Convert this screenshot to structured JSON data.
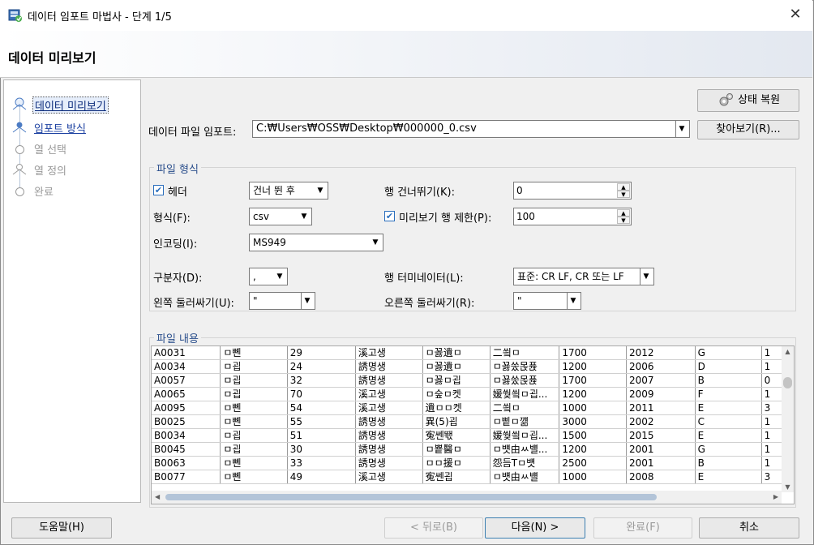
{
  "window": {
    "title": "데이터 임포트 마법사 - 단계 1/5",
    "close_glyph": "✕",
    "header_title": "데이터 미리보기"
  },
  "nav": {
    "items": [
      {
        "label": "데이터 미리보기",
        "state": "active"
      },
      {
        "label": "임포트 방식",
        "state": "link"
      },
      {
        "label": "열 선택",
        "state": "disabled"
      },
      {
        "label": "열 정의",
        "state": "disabled"
      },
      {
        "label": "완료",
        "state": "disabled"
      }
    ]
  },
  "top": {
    "restore_label": "상태 복원",
    "file_label": "데이터 파일 임포트:",
    "file_value": "C:₩Users₩OSS₩Desktop₩000000_0.csv",
    "browse_label": "찾아보기(R)..."
  },
  "file_format": {
    "group_title": "파일 형식",
    "header_label": "헤더",
    "header_checked": true,
    "header_option": "건너 뛴 후",
    "skip_rows_label": "행 건너뛰기(K):",
    "skip_rows_value": "0",
    "format_label": "형식(F):",
    "format_value": "csv",
    "preview_limit_label": "미리보기 행 제한(P):",
    "preview_limit_checked": true,
    "preview_limit_value": "100",
    "encoding_label": "인코딩(I):",
    "encoding_value": "MS949",
    "delimiter_label": "구분자(D):",
    "delimiter_value": ",",
    "line_term_label": "행 터미네이터(L):",
    "line_term_value": "표준: CR LF, CR 또는 LF",
    "left_encl_label": "왼쪽 둘러싸기(U):",
    "left_encl_value": "\"",
    "right_encl_label": "오른쪽 둘러싸기(R):",
    "right_encl_value": "\""
  },
  "contents": {
    "group_title": "파일 내용",
    "rows": [
      [
        "A0031",
        "ㅁ뼨",
        "29",
        "溪고생",
        "ㅁ꾫遺ㅁ",
        "二씤ㅁ",
        "1700",
        "2012",
        "G",
        "1"
      ],
      [
        "A0034",
        "ㅁ굅",
        "24",
        "誘명생",
        "ㅁ꾫遺ㅁ",
        "ㅁ꾫쑸몭퓭",
        "1200",
        "2006",
        "D",
        "1"
      ],
      [
        "A0057",
        "ㅁ굅",
        "32",
        "誘명생",
        "ㅁ꾫ㅁ굅",
        "ㅁ꾫쑸몭퓭",
        "1700",
        "2007",
        "B",
        "0"
      ],
      [
        "A0065",
        "ㅁ굅",
        "70",
        "溪고생",
        "ㅁ숲ㅁ켓",
        "媛쒖씤ㅁ굅...",
        "1200",
        "2009",
        "F",
        "1"
      ],
      [
        "A0095",
        "ㅁ뼨",
        "54",
        "溪고생",
        "遺ㅁㅁ켓",
        "二씤ㅁ",
        "1000",
        "2011",
        "E",
        "3"
      ],
      [
        "B0025",
        "ㅁ뼨",
        "55",
        "誘명생",
        "異(5)굅",
        "ㅁ삩ㅁ꺪",
        "3000",
        "2002",
        "C",
        "1"
      ],
      [
        "B0034",
        "ㅁ굅",
        "51",
        "誘명생",
        "寃쎈뙋",
        "媛쒖씤ㅁ굅...",
        "1500",
        "2015",
        "E",
        "1"
      ],
      [
        "B0045",
        "ㅁ굅",
        "30",
        "誘명생",
        "ㅁ뿉醫ㅁ",
        "ㅁ뱻由ㅆ뱰...",
        "1200",
        "2001",
        "G",
        "1"
      ],
      [
        "B0063",
        "ㅁ뼨",
        "33",
        "誘명생",
        "ㅁㅁ援ㅁ",
        "怨듬Tㅁ뱻",
        "2500",
        "2001",
        "B",
        "1"
      ],
      [
        "B0077",
        "ㅁ뼨",
        "49",
        "溪고생",
        "寃쎈굅",
        "ㅁ뱻由ㅆ뱰",
        "1000",
        "2008",
        "E",
        "3"
      ]
    ]
  },
  "footer": {
    "help_label": "도움말(H)",
    "back_label": "< 뒤로(B)",
    "next_label": "다음(N) >",
    "finish_label": "완료(F)",
    "cancel_label": "취소"
  }
}
